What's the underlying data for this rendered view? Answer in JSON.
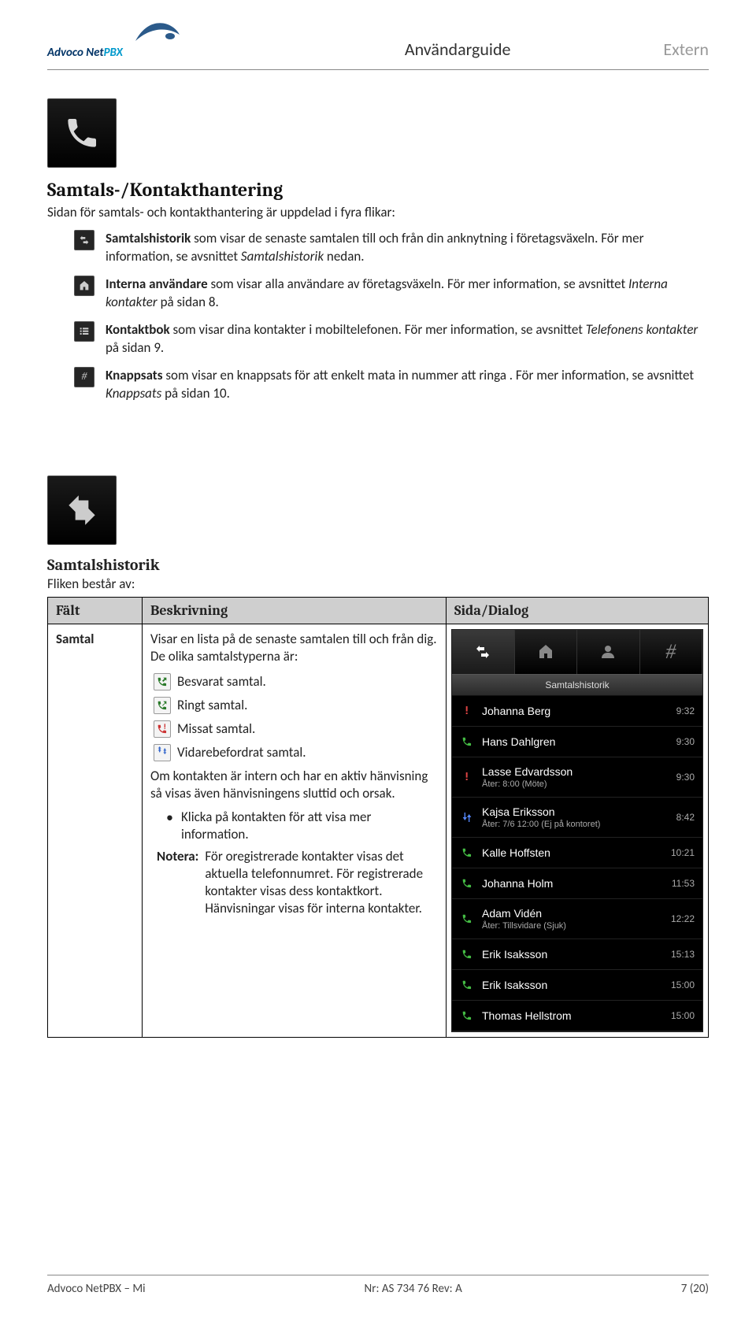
{
  "header": {
    "logo_line1": "Advoco Net",
    "logo_line2": "PBX",
    "center": "Användarguide",
    "right": "Extern"
  },
  "section1": {
    "title": "Samtals-/Kontakthantering",
    "intro": "Sidan för samtals- och kontakthantering är uppdelad i fyra flikar:",
    "items": [
      {
        "icon": "history",
        "bold": "Samtalshistorik",
        "text_a": " som visar de senaste samtalen till och från din anknytning i företagsväxeln. För mer information, se avsnittet ",
        "italic": "Samtalshistorik",
        "text_b": " nedan."
      },
      {
        "icon": "house",
        "bold": "Interna användare",
        "text_a": " som visar alla användare av företagsväxeln. För mer information, se avsnittet ",
        "italic": "Interna kontakter",
        "text_b": " på sidan 8."
      },
      {
        "icon": "list",
        "bold": "Kontaktbok",
        "text_a": " som visar dina kontakter i mobiltelefonen. För mer information, se avsnittet ",
        "italic": "Telefonens kontakter",
        "text_b": " på sidan 9."
      },
      {
        "icon": "hash",
        "bold": "Knappsats",
        "text_a": " som visar en knappsats för att enkelt mata in nummer att ringa . För mer information, se avsnittet ",
        "italic": "Knappsats",
        "text_b": " på sidan 10."
      }
    ]
  },
  "section2": {
    "title": "Samtalshistorik",
    "intro": "Fliken består av:",
    "table": {
      "headers": {
        "falt": "Fält",
        "besk": "Beskrivning",
        "dialog": "Sida/Dialog"
      },
      "row": {
        "falt": "Samtal",
        "besk_main": "Visar en lista på de senaste samtalen till och från dig. De olika samtalstyperna är:",
        "types": [
          {
            "kind": "answered",
            "label": "Besvarat samtal."
          },
          {
            "kind": "outgoing",
            "label": "Ringt samtal."
          },
          {
            "kind": "missed",
            "label": "Missat samtal."
          },
          {
            "kind": "forwarded",
            "label": "Vidarebefordrat samtal."
          }
        ],
        "p_after": "Om kontakten är intern och har en aktiv hänvisning så visas även hänvisningens sluttid och orsak.",
        "bullet": "Klicka på kontakten för att visa mer information.",
        "notera_label": "Notera:",
        "notera_text": "För oregistrerade kontakter visas det aktuella telefonnumret. För registrerade kontakter visas dess kontaktkort. Hänvisningar visas för interna kontakter."
      }
    }
  },
  "phone": {
    "subheader": "Samtalshistorik",
    "rows": [
      {
        "icon": "missed",
        "name": "Johanna Berg",
        "sub": "",
        "time": "9:32"
      },
      {
        "icon": "answered",
        "name": "Hans Dahlgren",
        "sub": "",
        "time": "9:30"
      },
      {
        "icon": "missed",
        "name": "Lasse Edvardsson",
        "sub": "Åter: 8:00 (Möte)",
        "time": "9:30"
      },
      {
        "icon": "forwarded",
        "name": "Kajsa Eriksson",
        "sub": "Åter: 7/6 12:00 (Ej på kontoret)",
        "time": "8:42"
      },
      {
        "icon": "outgoing",
        "name": "Kalle Hoffsten",
        "sub": "",
        "time": "10:21"
      },
      {
        "icon": "outgoing",
        "name": "Johanna Holm",
        "sub": "",
        "time": "11:53"
      },
      {
        "icon": "answered",
        "name": "Adam Vidén",
        "sub": "Åter: Tillsvidare (Sjuk)",
        "time": "12:22"
      },
      {
        "icon": "outgoing",
        "name": "Erik Isaksson",
        "sub": "",
        "time": "15:13"
      },
      {
        "icon": "answered",
        "name": "Erik Isaksson",
        "sub": "",
        "time": "15:00"
      },
      {
        "icon": "outgoing",
        "name": "Thomas Hellstrom",
        "sub": "",
        "time": "15:00"
      }
    ]
  },
  "footer": {
    "left": "Advoco NetPBX – Mi",
    "center": "Nr: AS 734 76 Rev: A",
    "right": "7 (20)"
  }
}
